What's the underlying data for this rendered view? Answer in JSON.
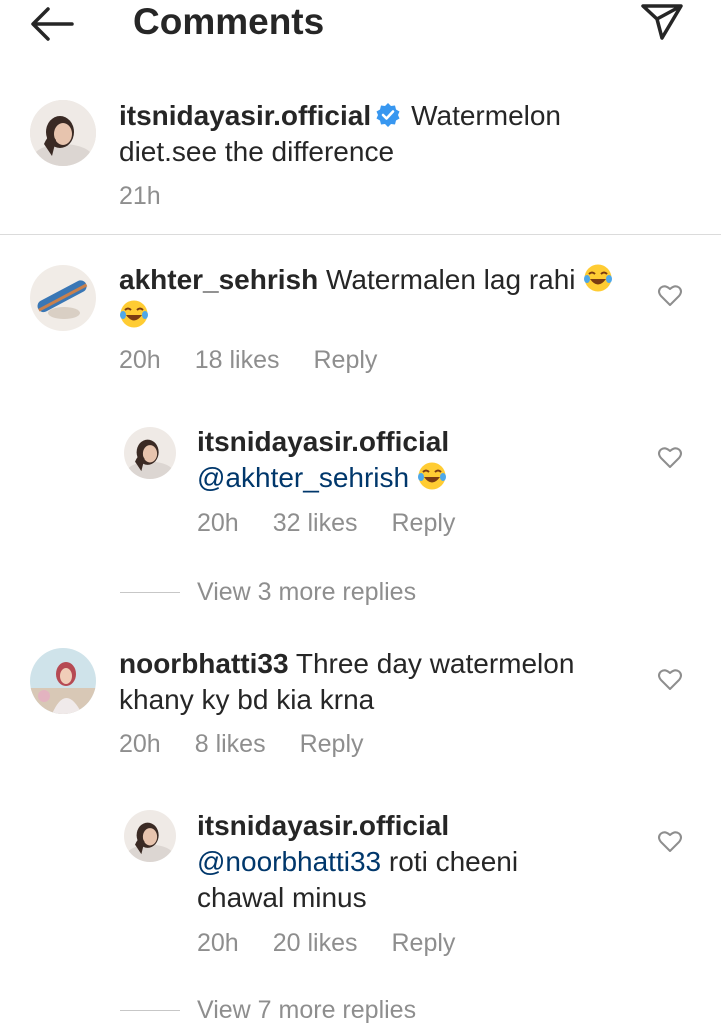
{
  "header": {
    "title": "Comments"
  },
  "caption": {
    "username": "itsnidayasir.official",
    "text_line1": "Watermelon",
    "text_line2": "diet.see the difference",
    "time": "21h"
  },
  "comments": [
    {
      "username": "akhter_sehrish",
      "text": "Watermalen lag rahi",
      "emoji": "😂",
      "time": "20h",
      "likes": "18 likes",
      "reply": "Reply",
      "reply_item": {
        "username": "itsnidayasir.official",
        "mention": "@akhter_sehrish",
        "text": "",
        "emoji": "😂",
        "time": "20h",
        "likes": "32 likes",
        "reply": "Reply"
      },
      "view_more": "View 3 more replies"
    },
    {
      "username": "noorbhatti33",
      "text_line1": "Three day watermelon",
      "text_line2": "khany ky bd kia krna",
      "time": "20h",
      "likes": "8 likes",
      "reply": "Reply",
      "reply_item": {
        "username": "itsnidayasir.official",
        "mention": "@noorbhatti33",
        "text_line1": "roti cheeni",
        "text_line2": "chawal minus",
        "time": "20h",
        "likes": "20 likes",
        "reply": "Reply"
      },
      "view_more": "View 7 more replies"
    }
  ],
  "icons": {
    "back": "arrow-left-icon",
    "send": "paper-plane-icon",
    "like": "heart-outline-icon",
    "verified": "verified-badge-icon"
  },
  "colors": {
    "mention": "#00376b",
    "meta": "#8e8e8e",
    "verified": "#3897f0"
  }
}
